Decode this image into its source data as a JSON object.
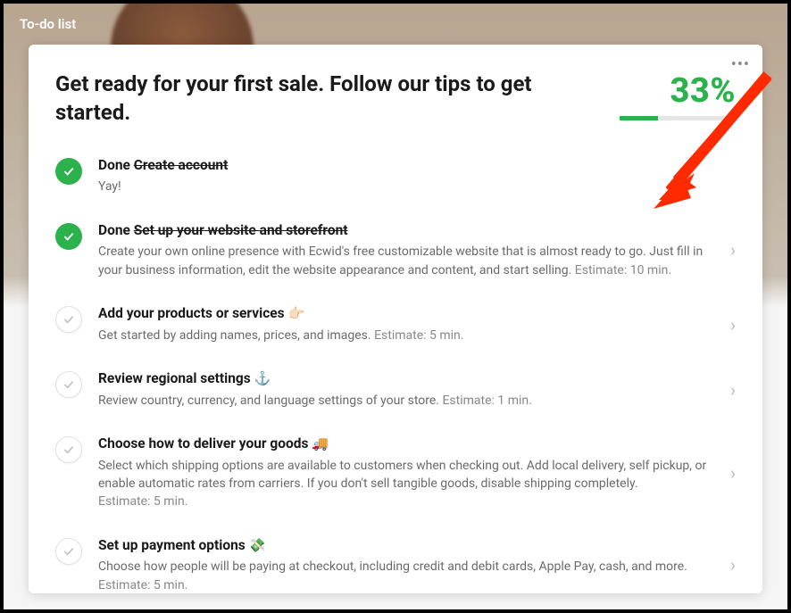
{
  "page": {
    "title": "To-do list"
  },
  "card": {
    "title": "Get ready for your first sale. Follow our tips to get started.",
    "progress_percent": "33%",
    "progress_value": 33
  },
  "items": [
    {
      "done": true,
      "done_prefix": "Done ",
      "title_strike": "Create account",
      "description": "Yay!",
      "estimate": "",
      "emoji": "",
      "has_chevron": false
    },
    {
      "done": true,
      "done_prefix": "Done ",
      "title_strike": "Set up your website and storefront",
      "description": "Create your own online presence with Ecwid's free customizable website that is almost ready to go. Just fill in your business information, edit the website appearance and content, and start selling. ",
      "estimate": "Estimate: 10 min.",
      "emoji": "",
      "has_chevron": true
    },
    {
      "done": false,
      "title": "Add your products or services ",
      "emoji": "👉🏻",
      "description": "Get started by adding names, prices, and images. ",
      "estimate": "Estimate: 5 min.",
      "has_chevron": true
    },
    {
      "done": false,
      "title": "Review regional settings ",
      "emoji": "⚓",
      "description": "Review country, currency, and language settings of your store. ",
      "estimate": "Estimate: 1 min.",
      "has_chevron": true
    },
    {
      "done": false,
      "title": "Choose how to deliver your goods ",
      "emoji": "🚚",
      "description": "Select which shipping options are available to customers when checking out. Add local delivery, self pickup, or enable automatic rates from carriers. If you don't sell tangible goods, disable shipping completely.",
      "estimate": "Estimate: 5 min.",
      "has_chevron": true
    },
    {
      "done": false,
      "title": "Set up payment options ",
      "emoji": "💸",
      "description": "Choose how people will be paying at checkout, including credit and debit cards, Apple Pay, cash, and more.",
      "estimate": "Estimate: 5 min.",
      "has_chevron": true
    }
  ]
}
